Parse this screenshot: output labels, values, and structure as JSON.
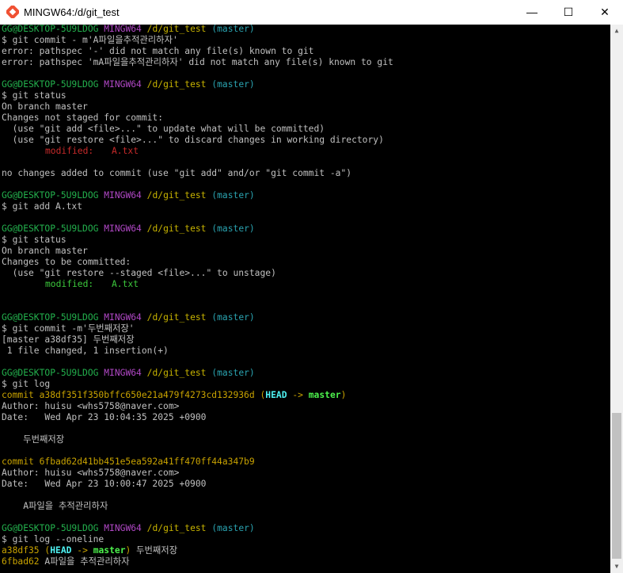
{
  "window": {
    "title": "MINGW64:/d/git_test",
    "minimize_glyph": "—",
    "maximize_glyph": "☐",
    "close_glyph": "✕",
    "icon": "git-bash-icon"
  },
  "prompt": {
    "user": "GG@DESKTOP-5U9LDOG",
    "env": "MINGW64",
    "path": "/d/git_test",
    "branch": "(master)"
  },
  "terminal": {
    "l1_cmd": "$ git commit - m'A파일을추적관리하자'",
    "l2": "error: pathspec '-' did not match any file(s) known to git",
    "l3": "error: pathspec 'mA파일을추적관리하자' did not match any file(s) known to git",
    "l4_cmd": "$ git status",
    "l5": "On branch master",
    "l6": "Changes not staged for commit:",
    "l7": "  (use \"git add <file>...\" to update what will be committed)",
    "l8": "  (use \"git restore <file>...\" to discard changes in working directory)",
    "l9_label": "modified:",
    "l9_file": "A.txt",
    "l10": "no changes added to commit (use \"git add\" and/or \"git commit -a\")",
    "l11_cmd": "$ git add A.txt",
    "l12_cmd": "$ git status",
    "l13": "On branch master",
    "l14": "Changes to be committed:",
    "l15": "  (use \"git restore --staged <file>...\" to unstage)",
    "l16_label": "modified:",
    "l16_file": "A.txt",
    "l17_cmd": "$ git commit -m'두번째저장'",
    "l18": "[master a38df35] 두번째저장",
    "l19": " 1 file changed, 1 insertion(+)",
    "l20_cmd": "$ git log",
    "l21_commit": "commit a38df351f350bffc650e21a479f4273cd132936d",
    "l21_head": "HEAD",
    "l21_arrow": "->",
    "l21_master": "master",
    "l22": "Author: huisu <whs5758@naver.com>",
    "l23": "Date:   Wed Apr 23 10:04:35 2025 +0900",
    "l24": "    두번째저장",
    "l25_commit": "commit 6fbad62d41bb451e5ea592a41ff470ff44a347b9",
    "l26": "Author: huisu <whs5758@naver.com>",
    "l27": "Date:   Wed Apr 23 10:00:47 2025 +0900",
    "l28": "    A파일을 추적관리하자",
    "l29_cmd": "$ git log --oneline",
    "l30_hash": "a38df35",
    "l30_head": "HEAD",
    "l30_arrow": "->",
    "l30_master": "master",
    "l30_msg": "두번째저장",
    "l31_hash": "6fbad62",
    "l31_msg": "A파일을 추적관리하자"
  },
  "colors": {
    "user": "#23b14d",
    "env": "#b148c6",
    "path": "#c8b400",
    "branch": "#2aa3b0",
    "modified_unstaged": "#c82a2a",
    "modified_staged": "#3cc83c",
    "commit_hash": "#c9a300",
    "head": "#4ef2f2",
    "master": "#4cf04c"
  },
  "scrollbar": {
    "up_glyph": "▲",
    "down_glyph": "▼"
  }
}
